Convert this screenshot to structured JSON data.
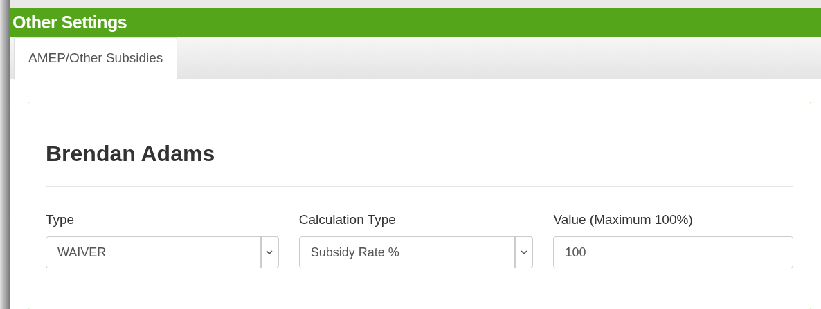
{
  "header": {
    "title": "Other Settings"
  },
  "tabs": [
    {
      "label": "AMEP/Other Subsidies",
      "selected": true
    }
  ],
  "panel": {
    "name": "Brendan Adams",
    "fields": [
      {
        "kind": "select",
        "label": "Type",
        "value": "WAIVER"
      },
      {
        "kind": "select",
        "label": "Calculation Type",
        "value": "Subsidy Rate %"
      },
      {
        "kind": "input",
        "label": "Value (Maximum 100%)",
        "value": "100"
      }
    ]
  }
}
